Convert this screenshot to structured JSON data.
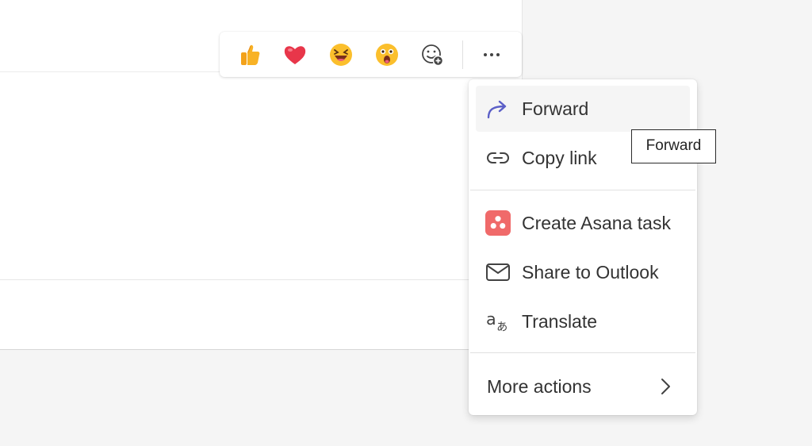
{
  "reactions": [
    {
      "name": "like",
      "icon": "thumbs-up-emoji"
    },
    {
      "name": "heart",
      "icon": "heart-emoji"
    },
    {
      "name": "laugh",
      "icon": "laughing-emoji"
    },
    {
      "name": "surprised",
      "icon": "surprised-emoji"
    },
    {
      "name": "add-reaction",
      "icon": "add-reaction-icon"
    },
    {
      "name": "more-options",
      "icon": "ellipsis-icon"
    }
  ],
  "menu": {
    "items": [
      {
        "label": "Forward",
        "icon": "forward-arrow-icon",
        "accent": "#5b5fc7"
      },
      {
        "label": "Copy link",
        "icon": "link-icon"
      },
      {
        "label": "Create Asana task",
        "icon": "asana-icon",
        "accent": "#f06a6a"
      },
      {
        "label": "Share to Outlook",
        "icon": "mail-icon"
      },
      {
        "label": "Translate",
        "icon": "translate-icon"
      }
    ],
    "more_actions_label": "More actions"
  },
  "tooltip": {
    "text": "Forward"
  }
}
